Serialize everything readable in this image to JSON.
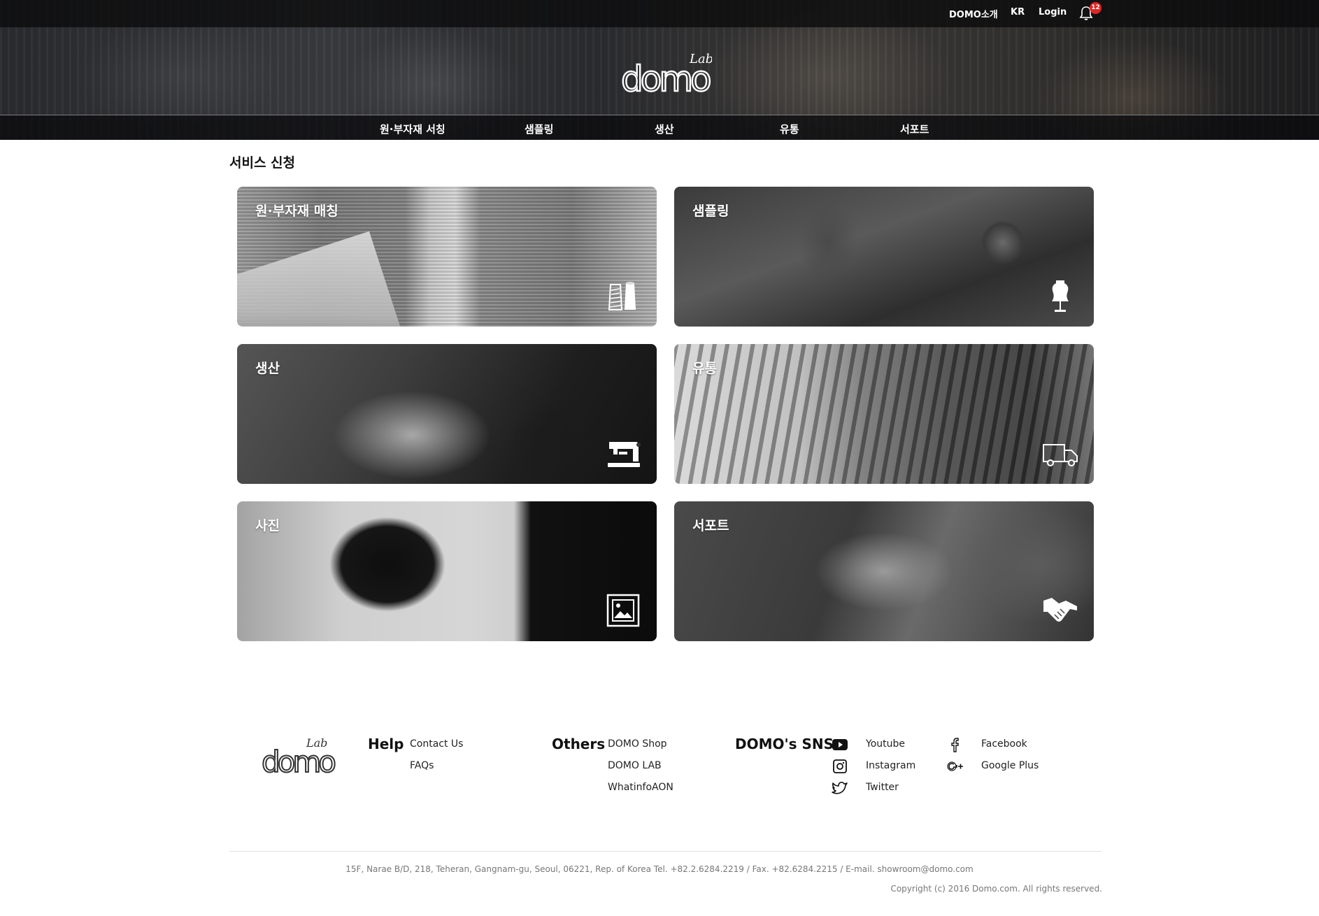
{
  "topbar": {
    "about_label": "DOMO소개",
    "lang_label": "KR",
    "login_label": "Login",
    "notification_count": "12"
  },
  "logo": {
    "wordmark": "domo",
    "sub": "Lab"
  },
  "nav": {
    "items": [
      {
        "label": "원·부자재 서칭"
      },
      {
        "label": "샘플링"
      },
      {
        "label": "생산"
      },
      {
        "label": "유통"
      },
      {
        "label": "서포트"
      }
    ]
  },
  "main": {
    "title": "서비스 신청",
    "cards": [
      {
        "label": "원·부자재 매칭",
        "icon": "thread-spool-icon"
      },
      {
        "label": "샘플링",
        "icon": "dress-form-icon"
      },
      {
        "label": "생산",
        "icon": "sewing-machine-icon"
      },
      {
        "label": "유통",
        "icon": "truck-icon"
      },
      {
        "label": "사진",
        "icon": "photo-frame-icon"
      },
      {
        "label": "서포트",
        "icon": "handshake-icon"
      }
    ]
  },
  "footer": {
    "help": {
      "heading": "Help",
      "links": [
        "Contact Us",
        "FAQs"
      ]
    },
    "others": {
      "heading": "Others",
      "links": [
        "DOMO Shop",
        "DOMO LAB",
        "WhatinfoAON"
      ]
    },
    "sns": {
      "heading": "DOMO's SNS",
      "links": [
        {
          "label": "Youtube",
          "icon": "youtube-icon"
        },
        {
          "label": "Instagram",
          "icon": "instagram-icon"
        },
        {
          "label": "Twitter",
          "icon": "twitter-icon"
        },
        {
          "label": "Facebook",
          "icon": "facebook-icon"
        },
        {
          "label": "Google Plus",
          "icon": "google-plus-icon"
        }
      ]
    },
    "address": "15F, Narae B/D, 218, Teheran, Gangnam-gu, Seoul, 06221, Rep. of Korea Tel. +82.2.6284.2219 / Fax. +82.6284.2215 / E-mail. showroom@domo.com",
    "copyright": "Copyright (c) 2016 Domo.com.  All rights reserved."
  },
  "colors": {
    "badge": "#e02424",
    "header_overlay": "#0a0a0c",
    "text": "#111111"
  }
}
